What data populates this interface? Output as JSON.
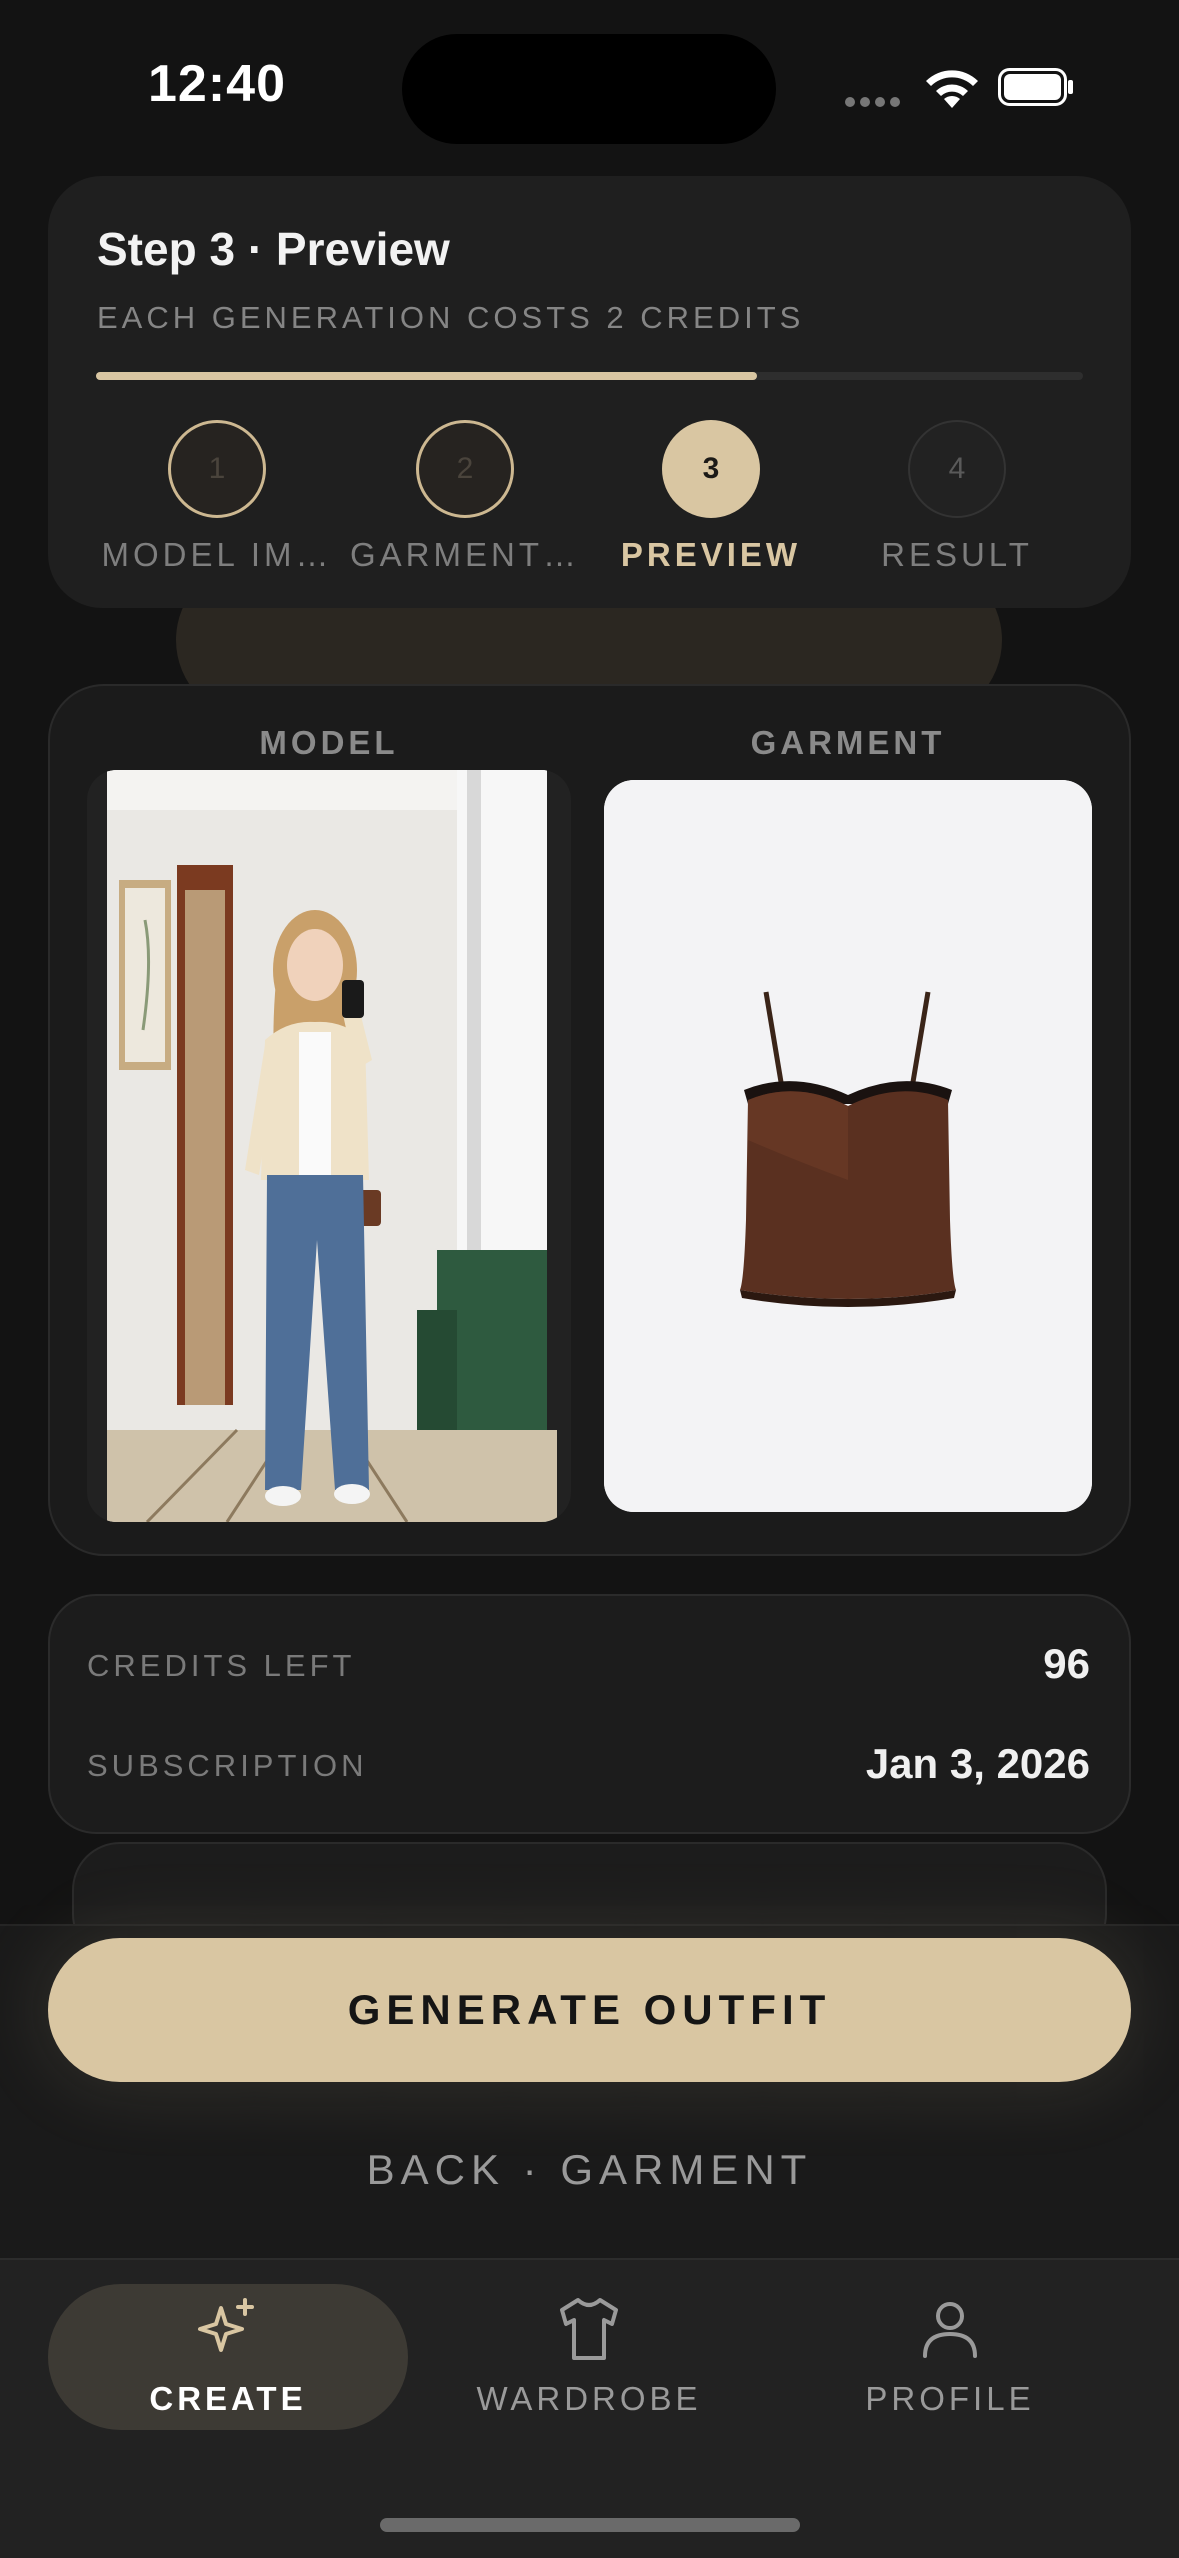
{
  "status_bar": {
    "time": "12:40"
  },
  "step_header": {
    "title": "Step 3 · Preview",
    "subtitle": "EACH GENERATION COSTS 2 CREDITS",
    "progress_fraction": 0.67,
    "steps": [
      {
        "number": "1",
        "label": "MODEL IM…",
        "state": "done"
      },
      {
        "number": "2",
        "label": "GARMENT…",
        "state": "done"
      },
      {
        "number": "3",
        "label": "PREVIEW",
        "state": "active"
      },
      {
        "number": "4",
        "label": "RESULT",
        "state": "pending"
      }
    ]
  },
  "preview": {
    "model_label": "MODEL",
    "garment_label": "GARMENT"
  },
  "credits": {
    "credits_left_label": "CREDITS LEFT",
    "credits_left_value": "96",
    "subscription_label": "SUBSCRIPTION",
    "subscription_value": "Jan 3, 2026"
  },
  "actions": {
    "generate_label": "GENERATE OUTFIT",
    "back_label": "BACK · GARMENT"
  },
  "tabbar": {
    "items": [
      {
        "label": "CREATE",
        "icon": "sparkles-icon",
        "active": true
      },
      {
        "label": "WARDROBE",
        "icon": "tshirt-icon",
        "active": false
      },
      {
        "label": "PROFILE",
        "icon": "person-icon",
        "active": false
      }
    ]
  },
  "colors": {
    "accent": "#d9c6a2",
    "background": "#131313",
    "card": "#1f1f1f"
  }
}
